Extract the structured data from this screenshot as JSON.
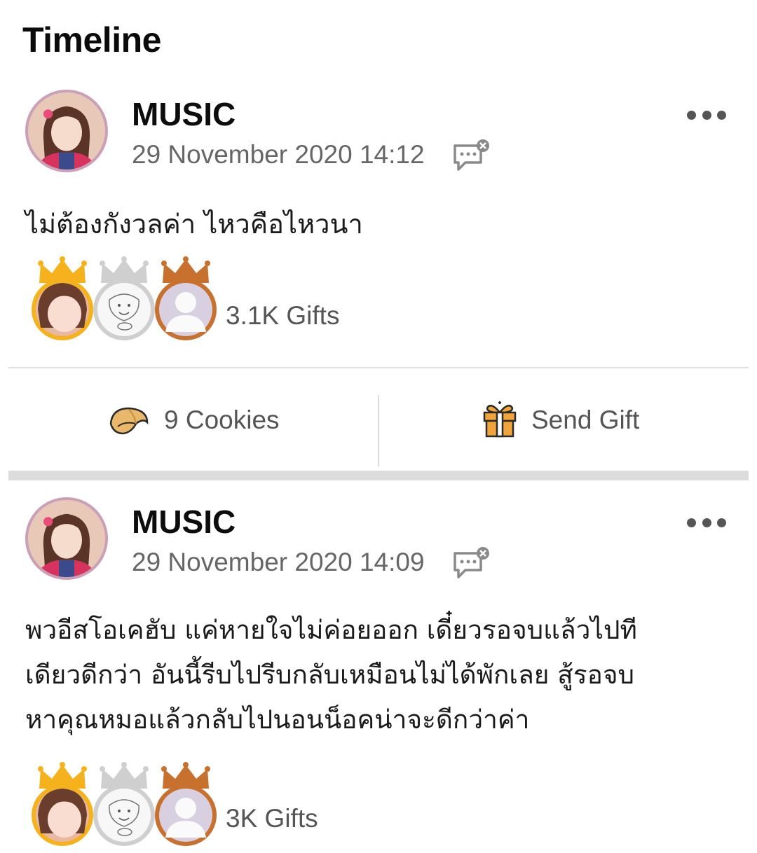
{
  "header": {
    "title": "Timeline"
  },
  "posts": [
    {
      "author": "MUSIC",
      "timestamp": "29 November 2020 14:12",
      "body": "ไม่ต้องกังวลค่า ไหวคือไหวนา",
      "gift_count": "3.1K Gifts",
      "gifter_ranks": [
        "gold",
        "silver",
        "bronze"
      ]
    },
    {
      "author": "MUSIC",
      "timestamp": "29 November 2020 14:09",
      "body": "พวอีสโอเคฮับ แค่หายใจไม่ค่อยออก เดี๋ยวรอจบแล้วไปที\nเดียวดีกว่า อันนี้รีบไปรีบกลับเหมือนไม่ได้พักเลย สู้รอจบ\nหาคุณหมอแล้วกลับไปนอนน็อคน่าจะดีกว่าค่า",
      "gift_count": "3K Gifts",
      "gifter_ranks": [
        "gold",
        "silver",
        "bronze"
      ]
    }
  ],
  "actions": {
    "cookies_label": "9 Cookies",
    "send_gift_label": "Send Gift"
  },
  "icons": {
    "more": "more-options-icon",
    "comment": "comment-disabled-icon",
    "cookie": "fortune-cookie-icon",
    "gift": "gift-box-icon",
    "crown": "crown-icon"
  },
  "colors": {
    "gold": "#F5B21C",
    "silver": "#CFCFCF",
    "bronze": "#C8702E",
    "text_secondary": "#666666",
    "divider": "#DCDCDC"
  }
}
